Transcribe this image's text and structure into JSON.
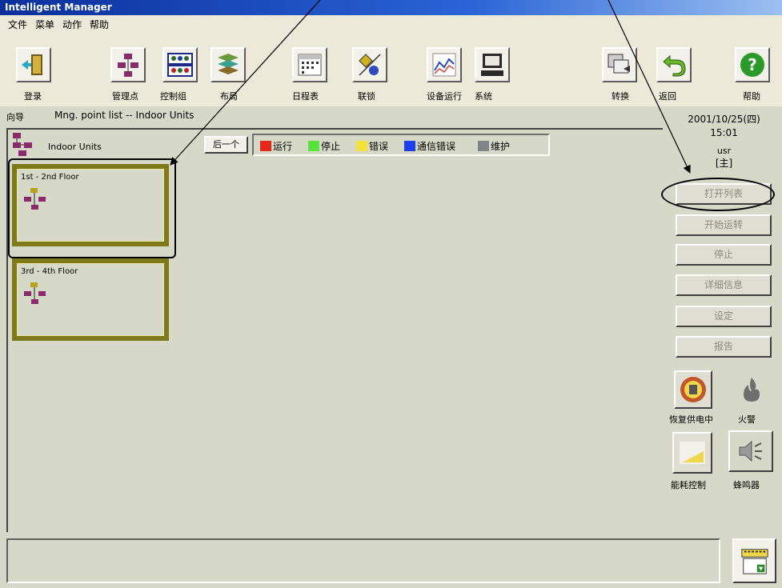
{
  "window": {
    "title": "Intelligent Manager"
  },
  "menu": [
    "文件",
    "菜单",
    "动作",
    "帮助"
  ],
  "toolbar": {
    "login": "登录",
    "mgmt_point": "管理点",
    "control": "控制组",
    "layout": "布局",
    "schedule": "日程表",
    "interlock": "联锁",
    "equipment_run": "设备运行",
    "system": "系统",
    "switch": "转换",
    "back": "返回",
    "help": "帮助"
  },
  "nav": {
    "label": "向导",
    "path": "Mng. point list -- Indoor Units"
  },
  "tree": {
    "label": "Indoor Units",
    "next_button": "后一个"
  },
  "legend": [
    {
      "label": "运行",
      "color": "#e8261c"
    },
    {
      "label": "停止",
      "color": "#58e23c"
    },
    {
      "label": "错误",
      "color": "#f3e23a"
    },
    {
      "label": "通信错误",
      "color": "#1d3ff0"
    },
    {
      "label": "维护",
      "color": "#7f8588"
    }
  ],
  "floors": [
    "1st - 2nd Floor",
    "3rd - 4th Floor"
  ],
  "status": {
    "date": "2001/10/25(四)",
    "time": "15:01",
    "user": "usr",
    "role": "[主]"
  },
  "actions": {
    "open_list": "打开列表",
    "start": "开始运转",
    "stop": "停止",
    "details": "详细信息",
    "settings": "设定",
    "report": "报告"
  },
  "emergency": {
    "power_restore": "恢复供电中",
    "fire": "火警",
    "energy": "能耗控制",
    "buzzer": "蜂鸣器"
  },
  "colors": {
    "panel": "#d6d9c7",
    "floor_frame": "#7e7a1a",
    "titlebar": "#0a2f9c"
  }
}
